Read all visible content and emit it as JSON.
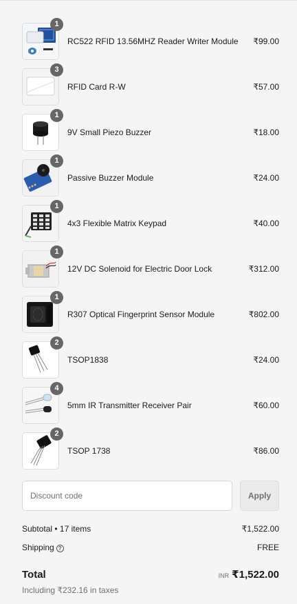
{
  "items": [
    {
      "name": "RC522 RFID 13.56MHZ Reader Writer Module",
      "price": "₹99.00",
      "qty": "1",
      "icon": "rfid-module"
    },
    {
      "name": "RFID Card R-W",
      "price": "₹57.00",
      "qty": "3",
      "icon": "rfid-card"
    },
    {
      "name": "9V Small Piezo Buzzer",
      "price": "₹18.00",
      "qty": "1",
      "icon": "buzzer"
    },
    {
      "name": "Passive Buzzer Module",
      "price": "₹24.00",
      "qty": "1",
      "icon": "buzzer-module"
    },
    {
      "name": "4x3 Flexible Matrix Keypad",
      "price": "₹40.00",
      "qty": "1",
      "icon": "keypad"
    },
    {
      "name": "12V DC Solenoid for Electric Door Lock",
      "price": "₹312.00",
      "qty": "1",
      "icon": "solenoid"
    },
    {
      "name": "R307 Optical Fingerprint Sensor Module",
      "price": "₹802.00",
      "qty": "1",
      "icon": "fingerprint-sensor"
    },
    {
      "name": "TSOP1838",
      "price": "₹24.00",
      "qty": "2",
      "icon": "ir-receiver"
    },
    {
      "name": "5mm IR Transmitter Receiver Pair",
      "price": "₹60.00",
      "qty": "4",
      "icon": "ir-led-pair"
    },
    {
      "name": "TSOP 1738",
      "price": "₹86.00",
      "qty": "2",
      "icon": "ir-receiver"
    }
  ],
  "discount": {
    "placeholder": "Discount code",
    "apply_label": "Apply"
  },
  "summary": {
    "subtotal_label": "Subtotal • 17 items",
    "subtotal_value": "₹1,522.00",
    "shipping_label": "Shipping",
    "shipping_value": "FREE",
    "total_label": "Total",
    "currency": "INR",
    "total_value": "₹1,522.00",
    "taxes_note": "Including ₹232.16 in taxes"
  }
}
